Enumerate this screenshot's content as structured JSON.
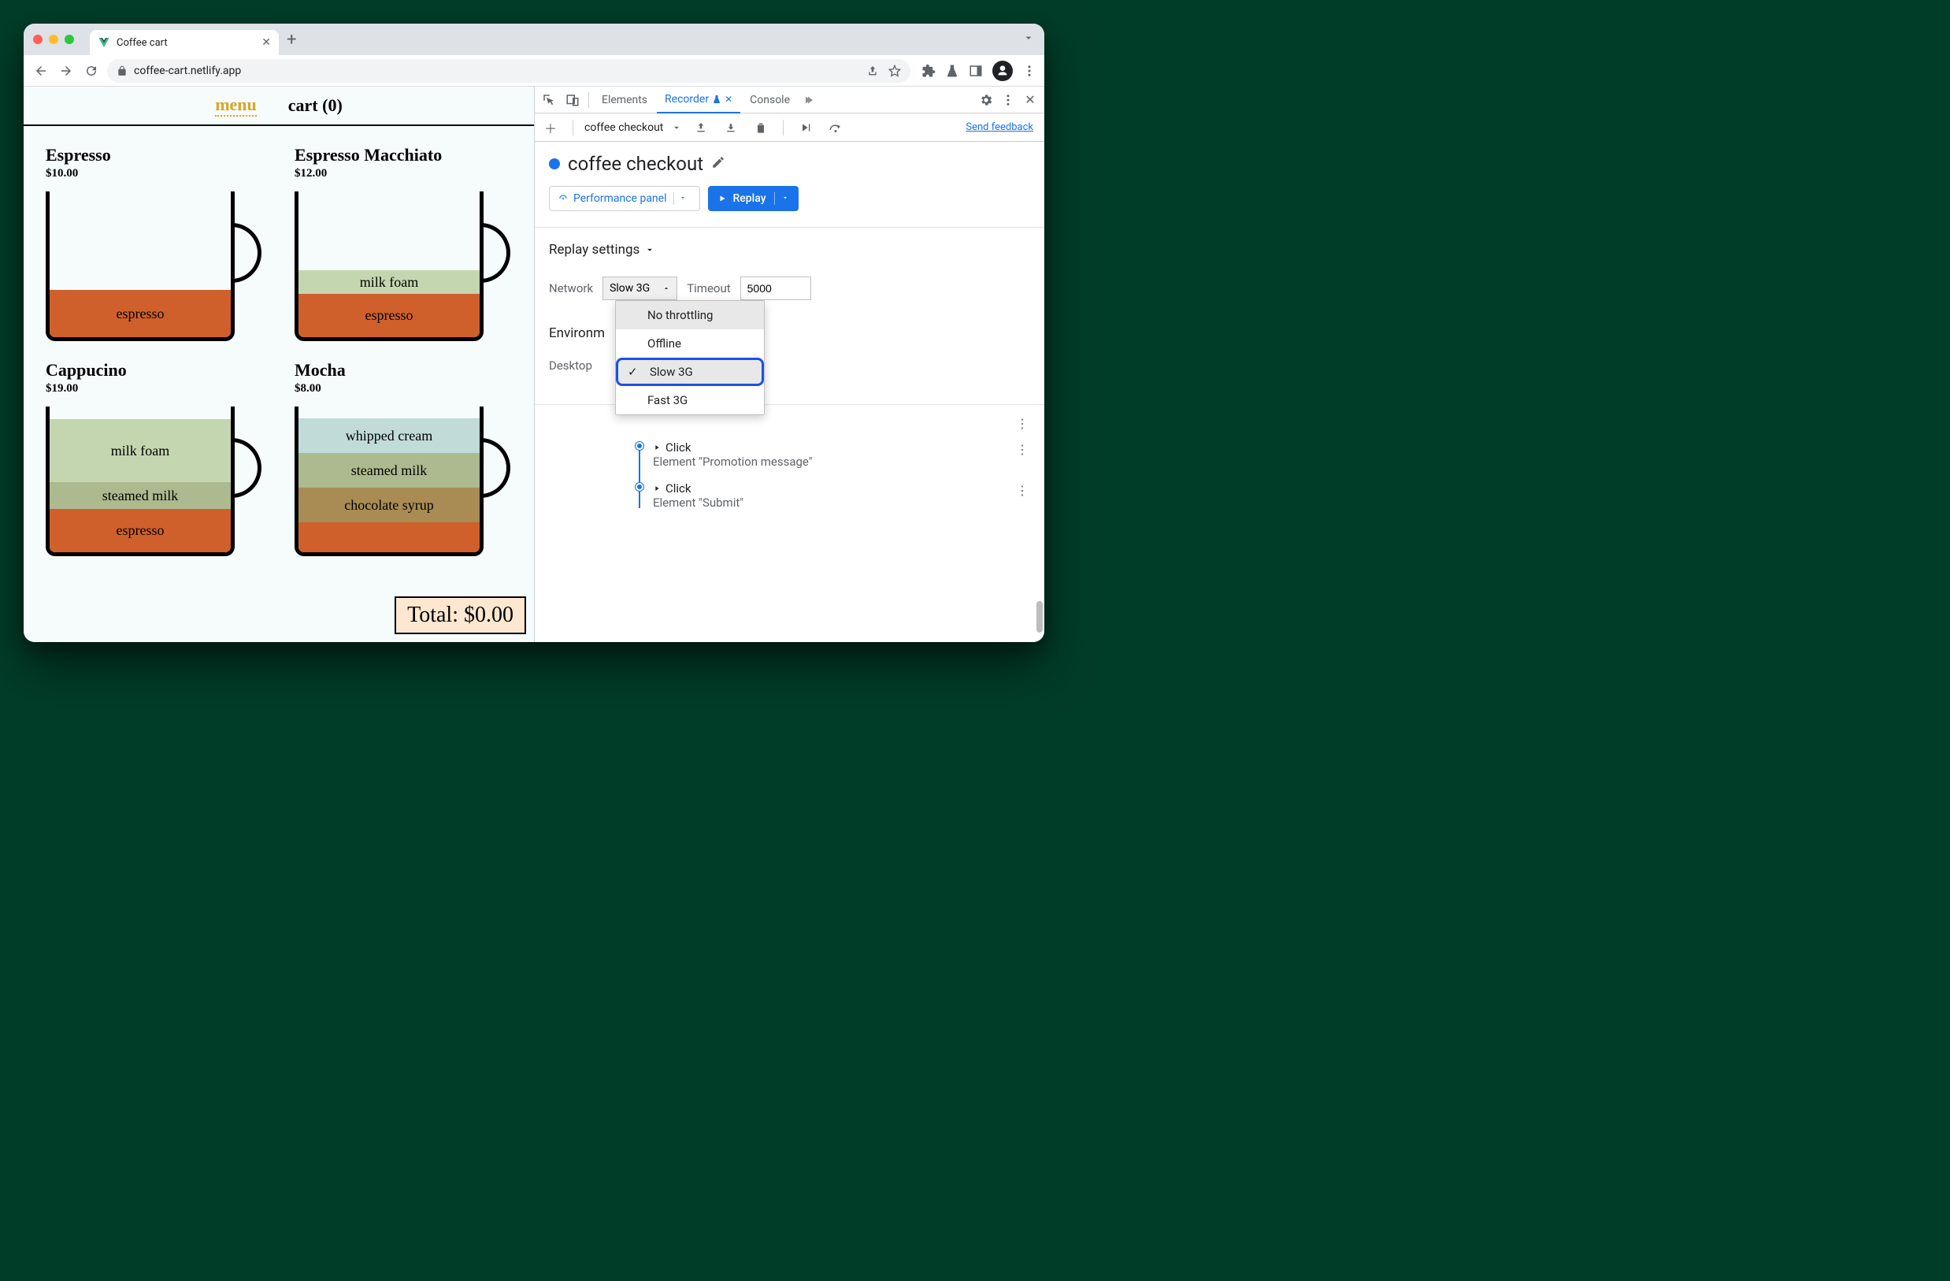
{
  "browser": {
    "tab_title": "Coffee cart",
    "url": "coffee-cart.netlify.app"
  },
  "page": {
    "nav": {
      "menu": "menu",
      "cart": "cart (0)"
    },
    "products": [
      {
        "name": "Espresso",
        "price": "$10.00",
        "layers": [
          {
            "name": "espresso",
            "cls": "espresso-l",
            "h": 60
          }
        ]
      },
      {
        "name": "Espresso Macchiato",
        "price": "$12.00",
        "layers": [
          {
            "name": "milk foam",
            "cls": "milkfoam-l",
            "h": 30
          },
          {
            "name": "espresso",
            "cls": "espresso-l",
            "h": 55
          }
        ]
      },
      {
        "name": "Cappucino",
        "price": "$19.00",
        "layers": [
          {
            "name": "milk foam",
            "cls": "milkfoam-l",
            "h": 80
          },
          {
            "name": "steamed milk",
            "cls": "steamed-l",
            "h": 34
          },
          {
            "name": "espresso",
            "cls": "espresso-l",
            "h": 55
          }
        ]
      },
      {
        "name": "Mocha",
        "price": "$8.00",
        "layers": [
          {
            "name": "whipped cream",
            "cls": "cream-l",
            "h": 44
          },
          {
            "name": "steamed milk",
            "cls": "steamed-l",
            "h": 44
          },
          {
            "name": "chocolate syrup",
            "cls": "choco-l",
            "h": 44
          },
          {
            "name": "",
            "cls": "espresso-l",
            "h": 38
          }
        ]
      }
    ],
    "total_label": "Total: $0.00"
  },
  "devtools": {
    "tabs": {
      "elements": "Elements",
      "recorder": "Recorder",
      "console": "Console"
    },
    "send_feedback": "Send feedback",
    "recording_selector": "coffee checkout",
    "recording_title": "coffee checkout",
    "perf_panel": "Performance panel",
    "replay": "Replay",
    "replay_settings_title": "Replay settings",
    "network_label": "Network",
    "network_value": "Slow 3G",
    "timeout_label": "Timeout",
    "timeout_value": "5000",
    "network_options": [
      "No throttling",
      "Offline",
      "Slow 3G",
      "Fast 3G"
    ],
    "env_title": "Environm",
    "env_sub": "Desktop",
    "steps": [
      {
        "title": "Click",
        "sub": "Element \"Promotion message\""
      },
      {
        "title": "Click",
        "sub": "Element \"Submit\""
      }
    ]
  }
}
